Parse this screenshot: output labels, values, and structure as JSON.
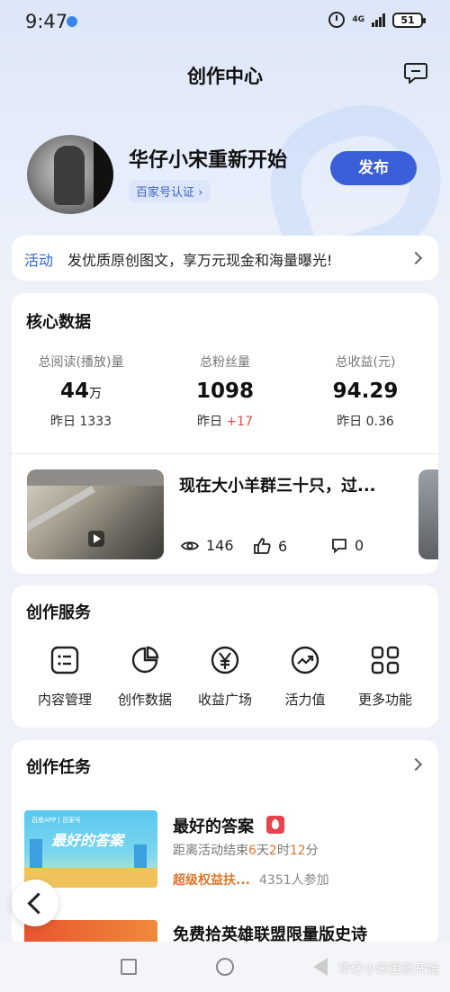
{
  "status_bar": {
    "time": "9:47",
    "network": "4G",
    "battery": "51"
  },
  "header": {
    "title": "创作中心"
  },
  "profile": {
    "name": "华仔小宋重新开始",
    "verify_label": "百家号认证 ›",
    "publish_label": "发布"
  },
  "activity": {
    "tag": "活动",
    "text": "发优质原创图文，享万元现金和海量曝光!"
  },
  "core_data": {
    "title": "核心数据",
    "stats": [
      {
        "label": "总阅读(播放)量",
        "value": "44",
        "unit": "万",
        "yesterday_label": "昨日",
        "yesterday_value": "1333"
      },
      {
        "label": "总粉丝量",
        "value": "1098",
        "unit": "",
        "yesterday_label": "昨日",
        "yesterday_value": "+17"
      },
      {
        "label": "总收益(元)",
        "value": "94.29",
        "unit": "",
        "yesterday_label": "昨日",
        "yesterday_value": "0.36"
      }
    ],
    "video": {
      "title": "现在大小羊群三十只，过...",
      "views": "146",
      "likes": "6",
      "comments": "0"
    }
  },
  "services": {
    "title": "创作服务",
    "items": [
      {
        "label": "内容管理",
        "icon": "list-icon"
      },
      {
        "label": "创作数据",
        "icon": "pie-chart-icon"
      },
      {
        "label": "收益广场",
        "icon": "yuan-icon"
      },
      {
        "label": "活力值",
        "icon": "trend-icon"
      },
      {
        "label": "更多功能",
        "icon": "grid-icon"
      }
    ]
  },
  "tasks": {
    "title": "创作任务",
    "items": [
      {
        "title": "最好的答案",
        "thumb_title": "最好的答案",
        "thumb_logo": "百度APP | 百家号",
        "countdown_prefix": "距离活动结束",
        "days": "6",
        "day_unit": "天",
        "hours": "2",
        "hour_unit": "时",
        "minutes": "12",
        "minute_unit": "分",
        "perk": "超级权益扶...",
        "joined": "4351人参加"
      },
      {
        "title": "免费拾英雄联盟限量版史诗"
      }
    ]
  },
  "watermark": "华仔小宋重新开始",
  "colors": {
    "accent": "#3b5fd9",
    "link": "#2e62d6",
    "orange": "#e0762b",
    "red": "#e24c4c"
  }
}
